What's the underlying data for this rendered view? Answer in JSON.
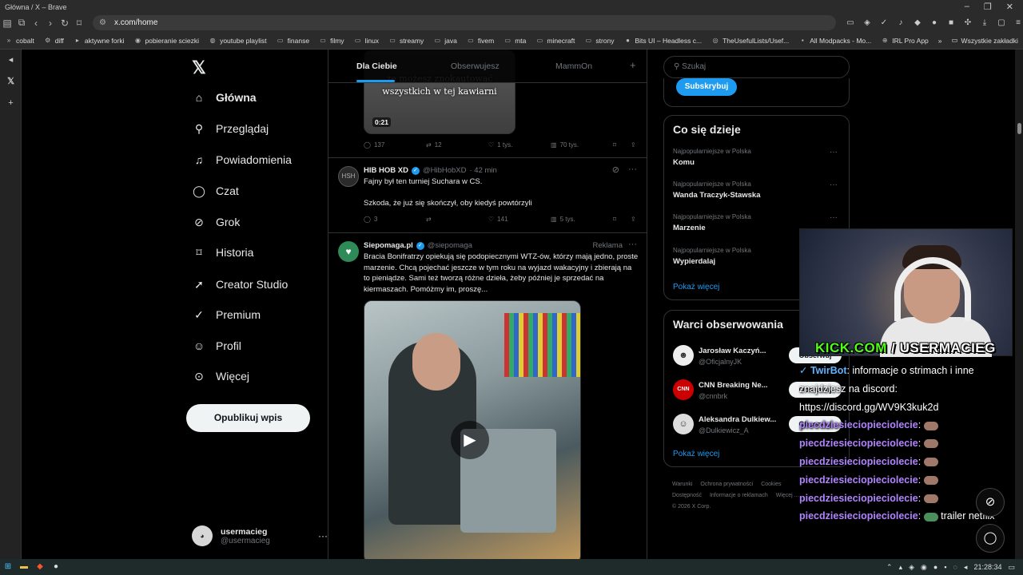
{
  "window": {
    "title": "Główna / X – Brave"
  },
  "browser": {
    "url": "x.com/home",
    "bookmarks": [
      "cobalt",
      "diff",
      "aktywne forki",
      "pobieranie sciezki",
      "youtube playlist",
      "finanse",
      "filmy",
      "linux",
      "streamy",
      "java",
      "fivem",
      "mta",
      "minecraft",
      "strony",
      "Bits UI – Headless c...",
      "TheUsefulLists/Usef...",
      "All Modpacks - Mo...",
      "IRL Pro App"
    ],
    "bookmarks_more": "»",
    "other_bookmarks": "Wszystkie zakładki"
  },
  "nav": {
    "items": [
      {
        "label": "Główna",
        "icon": "home-icon"
      },
      {
        "label": "Przeglądaj",
        "icon": "search-icon"
      },
      {
        "label": "Powiadomienia",
        "icon": "bell-icon"
      },
      {
        "label": "Czat",
        "icon": "chat-icon"
      },
      {
        "label": "Grok",
        "icon": "grok-icon"
      },
      {
        "label": "Historia",
        "icon": "bookmark-icon"
      },
      {
        "label": "Creator Studio",
        "icon": "rocket-icon"
      },
      {
        "label": "Premium",
        "icon": "verified-icon"
      },
      {
        "label": "Profil",
        "icon": "person-icon"
      },
      {
        "label": "Więcej",
        "icon": "more-circle-icon"
      }
    ],
    "post_button": "Opublikuj wpis",
    "account": {
      "name": "usermacieg",
      "handle": "@usermacieg"
    }
  },
  "timeline": {
    "tabs": [
      "Dla Ciebie",
      "Obserwujesz",
      "MammOn"
    ],
    "active_tab": "Dla Ciebie",
    "top_video": {
      "caption_line1": "że możesz znokautować",
      "caption_line2": "wszystkich w tej kawiarni",
      "duration": "0:21"
    },
    "top_actions": {
      "replies": "137",
      "reposts": "12",
      "likes": "1 tys.",
      "views": "70 tys."
    },
    "tweet1": {
      "name": "HIB HOB XD",
      "handle": "@HibHobXD",
      "time": "· 42 min",
      "line1": "Fajny był ten turniej Suchara w CS.",
      "line2": "Szkoda, że już się skończył, oby kiedyś powtórzyli",
      "replies": "3",
      "reposts": "",
      "likes": "141",
      "views": "5 tys."
    },
    "tweet2": {
      "name": "Siepomaga.pl",
      "handle": "@siepomaga",
      "label": "Reklama",
      "text": "Bracia Bonifratrzy opiekują się podopiecznymi WTZ-ów, którzy mają jedno, proste marzenie. Chcą pojechać jeszcze w tym roku na wyjazd wakacyjny i zbierają na to pieniądze. Sami też tworzą różne dzieła, żeby później je sprzedać na kiermaszach. Pomóżmy im, proszę..."
    }
  },
  "right": {
    "search_placeholder": "Szukaj",
    "subscribe": "Subskrybuj",
    "trends_title": "Co się dzieje",
    "trends": [
      {
        "context": "Najpopularniejsze w Polska",
        "topic": "Komu"
      },
      {
        "context": "Najpopularniejsze w Polska",
        "topic": "Wanda Traczyk-Stawska"
      },
      {
        "context": "Najpopularniejsze w Polska",
        "topic": "Marzenie"
      },
      {
        "context": "Najpopularniejsze w Polska",
        "topic": "Wypierdalaj"
      }
    ],
    "show_more": "Pokaż więcej",
    "who_title": "Warci obserwowania",
    "who": [
      {
        "name": "Jarosław Kaczyń...",
        "handle": "@OficjalnyJK",
        "button": "Obserwuj"
      },
      {
        "name": "CNN Breaking Ne...",
        "handle": "@cnnbrk",
        "button": "Obserwuj"
      },
      {
        "name": "Aleksandra Dulkiew...",
        "handle": "@Dulkiewicz_A",
        "button": "Obserwuj"
      }
    ],
    "who_more": "Pokaż więcej",
    "footer": [
      "Warunki",
      "Ochrona prywatności",
      "Cookies",
      "Dostępność",
      "Informacje o reklamach",
      "Więcej ...",
      "© 2026 X Corp."
    ]
  },
  "stream": {
    "kick_prefix": "KICK.COM",
    "kick_user": " / USERMACIEG",
    "bot_name": "TwirBot",
    "bot_msg": ": informacje o strimach i inne",
    "bot_msg2": "znajdziesz na discord:",
    "bot_link": "https://discord.gg/WV9K3kuk2d",
    "chat_user": "piecdziesieciopieciolecie",
    "last_msg": "trailer netflix"
  },
  "taskbar": {
    "time": "21:28:34"
  },
  "colors": {
    "accent": "#1d9bf0",
    "bg": "#000000",
    "kick_green": "#53fc18"
  }
}
